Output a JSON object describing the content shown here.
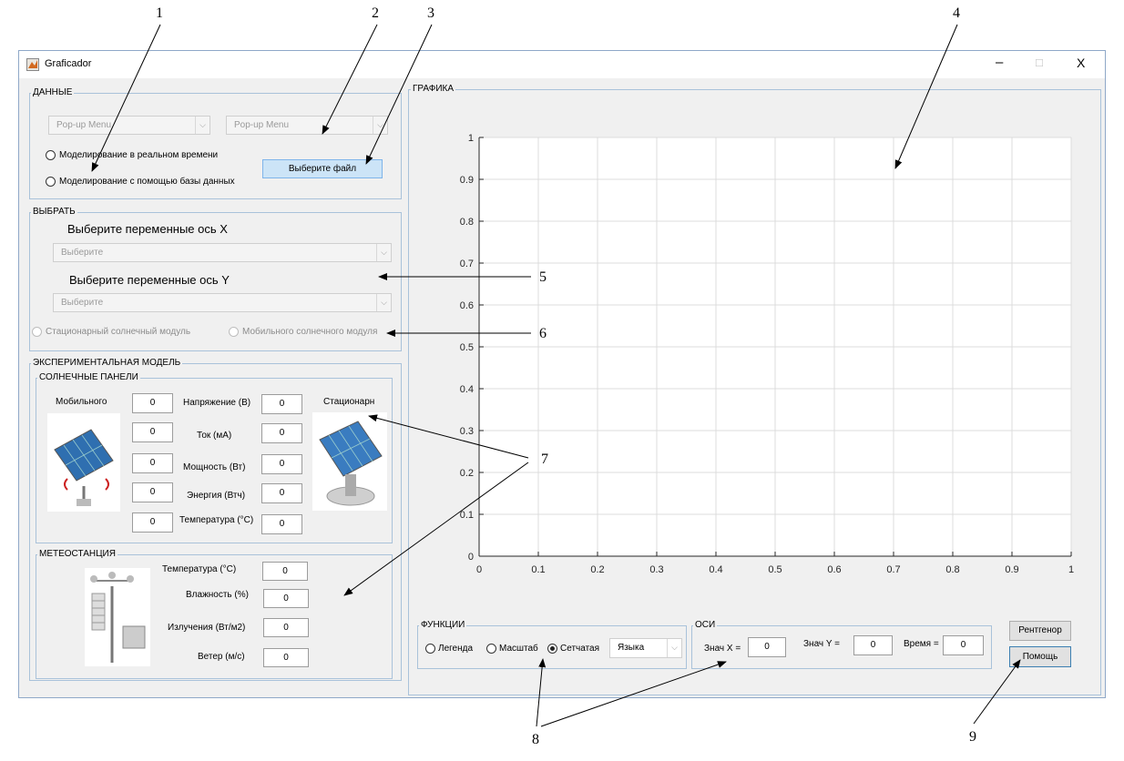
{
  "window": {
    "title": "Graficador",
    "minimize": "–",
    "maximize": "□",
    "close": "X"
  },
  "callouts": [
    "1",
    "2",
    "3",
    "4",
    "5",
    "6",
    "7",
    "8",
    "9"
  ],
  "data_panel": {
    "title": "ДАННЫЕ",
    "popup1": "Pop-up Menu",
    "popup2": "Pop-up Menu",
    "radio_realtime": "Моделирование в реальном времени",
    "radio_database": "Моделирование с помощью базы данных",
    "select_file": "Выберите файл"
  },
  "select_panel": {
    "title": "ВЫБРАТЬ",
    "x_label": "Выберите переменные ось X",
    "x_value": "Выберите",
    "y_label": "Выберите переменные ось Y",
    "y_value": "Выберите",
    "radio_stationary": "Стационарный солнечный модуль",
    "radio_mobile": "Мобильного солнечного модуля"
  },
  "experimental": {
    "title": "ЭКСПЕРИМЕНТАЛЬНАЯ МОДЕЛЬ",
    "solar_title": "СОЛНЕЧНЫЕ ПАНЕЛИ",
    "mobile_label": "Мобильного",
    "stationary_label": "Стационарн",
    "rows": [
      {
        "label": "Напряжение (В)",
        "left": "0",
        "right": "0"
      },
      {
        "label": "Ток (мА)",
        "left": "0",
        "right": "0"
      },
      {
        "label": "Мощность (Вт)",
        "left": "0",
        "right": "0"
      },
      {
        "label": "Энергия (Втч)",
        "left": "0",
        "right": "0"
      },
      {
        "label": "Температура (°C)",
        "left": "0",
        "right": "0"
      }
    ]
  },
  "weather": {
    "title": "МЕТЕОСТАНЦИЯ",
    "rows": [
      {
        "label": "Температура (°C)",
        "value": "0"
      },
      {
        "label": "Влажность (%)",
        "value": "0"
      },
      {
        "label": "Излучения (Вт/м2)",
        "value": "0"
      },
      {
        "label": "Ветер (м/с)",
        "value": "0"
      }
    ]
  },
  "graph_panel": {
    "title": "ГРАФИКА"
  },
  "functions": {
    "title": "ФУНКЦИИ",
    "legend": "Легенда",
    "scale": "Масштаб",
    "grid": "Сетчатая",
    "language": "Языка"
  },
  "axes_panel": {
    "title": "ОСИ",
    "x_label": "Знач X =",
    "x_value": "0",
    "y_label": "Знач Y =",
    "y_value": "0",
    "time_label": "Время =",
    "time_value": "0"
  },
  "buttons": {
    "xray": "Рентгенор",
    "help": "Помощь"
  },
  "chart_data": {
    "type": "line",
    "xlim": [
      0,
      1
    ],
    "ylim": [
      0,
      1
    ],
    "x_ticks": [
      "0",
      "0.1",
      "0.2",
      "0.3",
      "0.4",
      "0.5",
      "0.6",
      "0.7",
      "0.8",
      "0.9",
      "1"
    ],
    "y_ticks": [
      "0",
      "0.1",
      "0.2",
      "0.3",
      "0.4",
      "0.5",
      "0.6",
      "0.7",
      "0.8",
      "0.9",
      "1"
    ],
    "grid": true,
    "series": []
  },
  "colors": {
    "window_bg": "#f0f0f0",
    "panel_border": "#a9c2da",
    "button_hilite": "#cce4f7"
  }
}
